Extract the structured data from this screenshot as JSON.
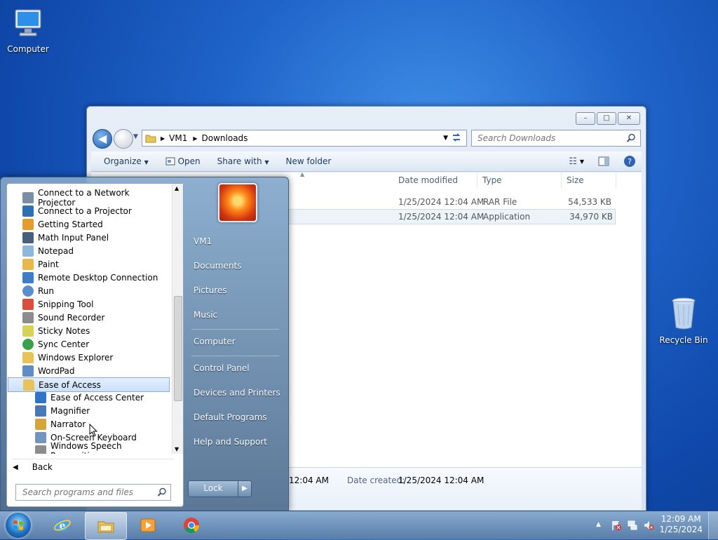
{
  "desktop": {
    "computer_label": "Computer",
    "recycle_label": "Recycle Bin"
  },
  "explorer": {
    "breadcrumb": [
      "VM1",
      "Downloads"
    ],
    "search_placeholder": "Search Downloads",
    "commands": [
      "Organize",
      "Open",
      "Share with",
      "New folder"
    ],
    "columns": [
      "Date modified",
      "Type",
      "Size"
    ],
    "files": [
      {
        "date": "1/25/2024 12:04 AM",
        "type": "RAR File",
        "size": "54,533 KB"
      },
      {
        "date": "1/25/2024 12:04 AM",
        "type": "Application",
        "size": "34,970 KB"
      }
    ],
    "details": {
      "modified_time": "12:04 AM",
      "created_label": "Date created:",
      "created_value": "1/25/2024 12:04 AM"
    }
  },
  "start_menu": {
    "programs": [
      {
        "label": "Connect to a Network Projector",
        "icon": "network-projector-icon"
      },
      {
        "label": "Connect to a Projector",
        "icon": "projector-icon"
      },
      {
        "label": "Getting Started",
        "icon": "getting-started-icon"
      },
      {
        "label": "Math Input Panel",
        "icon": "math-input-icon"
      },
      {
        "label": "Notepad",
        "icon": "notepad-icon"
      },
      {
        "label": "Paint",
        "icon": "paint-icon"
      },
      {
        "label": "Remote Desktop Connection",
        "icon": "remote-desktop-icon"
      },
      {
        "label": "Run",
        "icon": "run-icon"
      },
      {
        "label": "Snipping Tool",
        "icon": "snipping-tool-icon"
      },
      {
        "label": "Sound Recorder",
        "icon": "microphone-icon"
      },
      {
        "label": "Sticky Notes",
        "icon": "sticky-notes-icon"
      },
      {
        "label": "Sync Center",
        "icon": "sync-icon"
      },
      {
        "label": "Windows Explorer",
        "icon": "folder-icon"
      },
      {
        "label": "WordPad",
        "icon": "wordpad-icon"
      },
      {
        "label": "Ease of Access",
        "icon": "folder-icon"
      },
      {
        "label": "Ease of Access Center",
        "icon": "ease-of-access-icon"
      },
      {
        "label": "Magnifier",
        "icon": "magnifier-icon"
      },
      {
        "label": "Narrator",
        "icon": "narrator-icon"
      },
      {
        "label": "On-Screen Keyboard",
        "icon": "keyboard-icon"
      },
      {
        "label": "Windows Speech Recognition",
        "icon": "microphone-icon"
      }
    ],
    "back_label": "Back",
    "search_placeholder": "Search programs and files",
    "right_links": [
      "VM1",
      "Documents",
      "Pictures",
      "Music",
      "Computer",
      "Control Panel",
      "Devices and Printers",
      "Default Programs",
      "Help and Support"
    ],
    "lock_label": "Lock"
  },
  "taskbar": {
    "time": "12:09 AM",
    "date": "1/25/2024"
  },
  "colors": {
    "desktop_blue": "#1f63c9",
    "selection": "#cbe0fa"
  }
}
